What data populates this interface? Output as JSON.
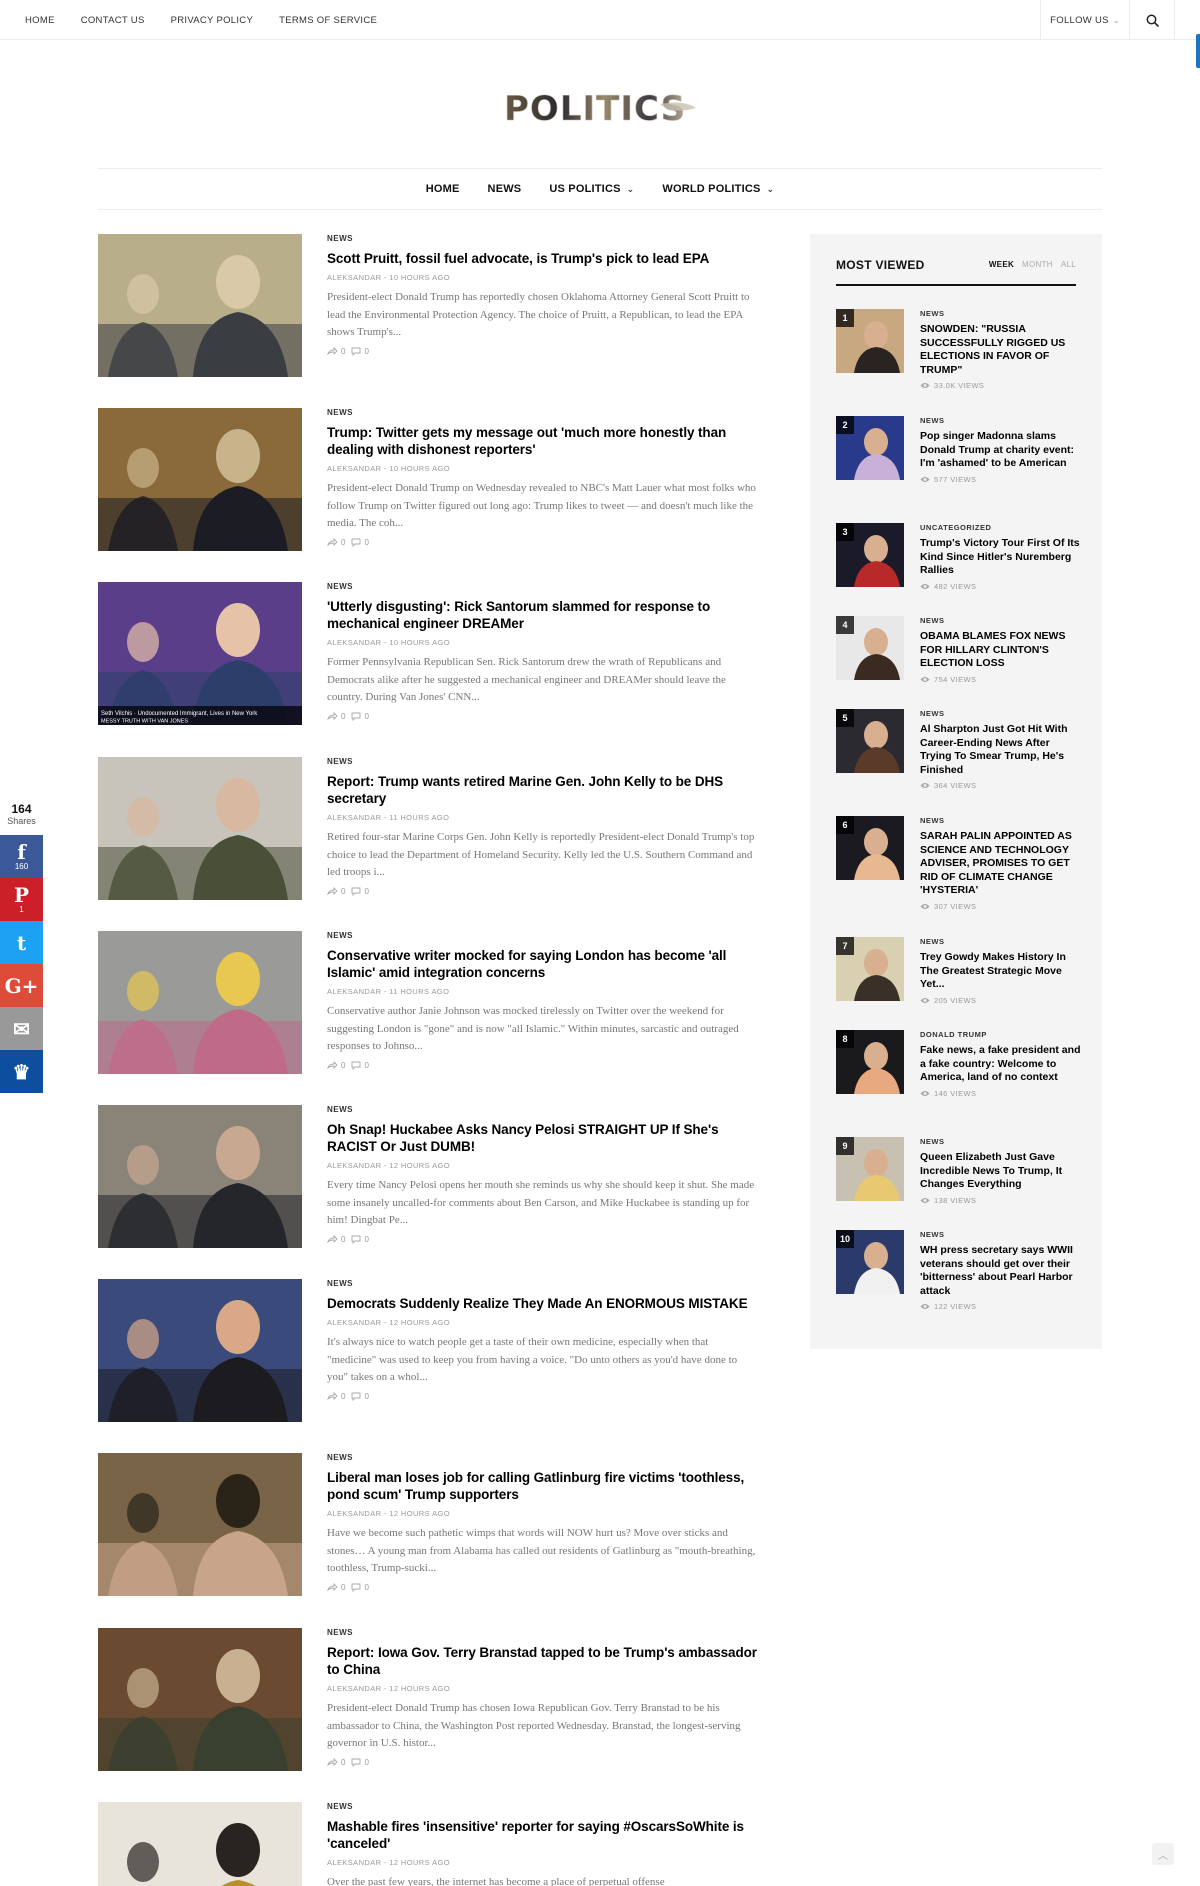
{
  "topnav": {
    "items": [
      "HOME",
      "CONTACT US",
      "PRIVACY POLICY",
      "TERMS OF SERVICE"
    ],
    "follow_label": "FOLLOW US"
  },
  "logo": {
    "text": "POLITICS"
  },
  "mainnav": {
    "items": [
      {
        "label": "HOME",
        "dropdown": false
      },
      {
        "label": "NEWS",
        "dropdown": false
      },
      {
        "label": "US POLITICS",
        "dropdown": true
      },
      {
        "label": "WORLD POLITICS",
        "dropdown": true
      }
    ]
  },
  "articles": [
    {
      "cat": "NEWS",
      "title": "Scott Pruitt, fossil fuel advocate, is Trump's pick to lead EPA",
      "byline": "ALEKSANDAR - 10 HOURS AGO",
      "excerpt": "President-elect Donald Trump has reportedly chosen Oklahoma Attorney General Scott Pruitt to lead the Environmental Protection Agency. The choice of Pruitt, a Republican, to lead the EPA shows Trump's...",
      "shares": "0",
      "comments": "0",
      "thumb_colors": [
        "#b8ae8a",
        "#3a3d42",
        "#d9c9a8"
      ]
    },
    {
      "cat": "NEWS",
      "title": "Trump: Twitter gets my message out 'much more honestly than dealing with dishonest reporters'",
      "byline": "ALEKSANDAR - 10 HOURS AGO",
      "excerpt": "President-elect Donald Trump on Wednesday revealed to NBC's Matt Lauer what most folks who follow Trump on Twitter figured out long ago: Trump likes to tweet — and doesn't much like the media. The coh...",
      "shares": "0",
      "comments": "0",
      "thumb_colors": [
        "#8a6a3a",
        "#1c1c24",
        "#c9b38a"
      ]
    },
    {
      "cat": "NEWS",
      "title": "'Utterly disgusting': Rick Santorum slammed for response to mechanical engineer DREAMer",
      "byline": "ALEKSANDAR - 10 HOURS AGO",
      "excerpt": "Former Pennsylvania Republican Sen. Rick Santorum drew the wrath of Republicans and Democrats alike after he suggested a mechanical engineer and DREAMer should leave the country. During Van Jones' CNN...",
      "shares": "0",
      "comments": "0",
      "thumb_colors": [
        "#5a3e8a",
        "#2c3f6a",
        "#e6c2a8"
      ],
      "caption1": "Seth Vilchis · Undocumented Immigrant, Lives in New York",
      "caption2": "MESSY TRUTH WITH VAN JONES"
    },
    {
      "cat": "NEWS",
      "title": "Report: Trump wants retired Marine Gen. John Kelly to be DHS secretary",
      "byline": "ALEKSANDAR - 11 HOURS AGO",
      "excerpt": "Retired four-star Marine Corps Gen. John Kelly is reportedly President-elect Donald Trump's top choice to lead the Department of Homeland Security. Kelly led the U.S. Southern Command and led troops i...",
      "shares": "0",
      "comments": "0",
      "thumb_colors": [
        "#c8c4bc",
        "#4a5038",
        "#d8b8a0"
      ]
    },
    {
      "cat": "NEWS",
      "title": "Conservative writer mocked for saying London has become 'all Islamic' amid integration concerns",
      "byline": "ALEKSANDAR - 11 HOURS AGO",
      "excerpt": "Conservative author Janie Johnson was mocked tirelessly on Twitter over the weekend for suggesting London is \"gone\" and is now \"all Islamic.\" Within minutes, sarcastic and outraged responses to Johnso...",
      "shares": "0",
      "comments": "0",
      "thumb_colors": [
        "#9a9a98",
        "#c06a8a",
        "#e8c850"
      ]
    },
    {
      "cat": "NEWS",
      "title": "Oh Snap! Huckabee Asks Nancy Pelosi STRAIGHT UP If She's RACIST Or Just DUMB!",
      "byline": "ALEKSANDAR - 12 HOURS AGO",
      "excerpt": "Every time Nancy Pelosi opens her mouth she reminds us why she should keep it shut. She made some insanely uncalled-for comments about Ben Carson, and Mike Huckabee is standing up for him! Dingbat Pe...",
      "shares": "0",
      "comments": "0",
      "thumb_colors": [
        "#8a8478",
        "#24262c",
        "#c8a890"
      ]
    },
    {
      "cat": "NEWS",
      "title": "Democrats Suddenly Realize They Made An ENORMOUS MISTAKE",
      "byline": "ALEKSANDAR - 12 HOURS AGO",
      "excerpt": "It's always nice to watch people get a taste of their own medicine, especially when that \"medicine\" was used to keep you from having a voice. \"Do unto others as you'd have done to you\" takes on a whol...",
      "shares": "0",
      "comments": "0",
      "thumb_colors": [
        "#3a4a7a",
        "#1c1c20",
        "#d8a888"
      ]
    },
    {
      "cat": "NEWS",
      "title": "Liberal man loses job for calling Gatlinburg fire victims 'toothless, pond scum' Trump supporters",
      "byline": "ALEKSANDAR - 12 HOURS AGO",
      "excerpt": "Have we become such pathetic wimps that words will NOW hurt us? Move over sticks and stones… A young man from Alabama has called out residents of Gatlinburg as \"mouth-breathing, toothless, Trump-sucki...",
      "shares": "0",
      "comments": "0",
      "thumb_colors": [
        "#7a6448",
        "#c8a48a",
        "#2a2418"
      ]
    },
    {
      "cat": "NEWS",
      "title": "Report: Iowa Gov. Terry Branstad tapped to be Trump's ambassador to China",
      "byline": "ALEKSANDAR - 12 HOURS AGO",
      "excerpt": "President-elect Donald Trump has chosen Iowa Republican Gov. Terry Branstad to be his ambassador to China, the Washington Post reported Wednesday. Branstad, the longest-serving governor in U.S. histor...",
      "shares": "0",
      "comments": "0",
      "thumb_colors": [
        "#6a4a30",
        "#3a4030",
        "#c8b090"
      ]
    },
    {
      "cat": "NEWS",
      "title": "Mashable fires 'insensitive' reporter for saying #OscarsSoWhite is 'canceled'",
      "byline": "ALEKSANDAR - 12 HOURS AGO",
      "excerpt": "Over the past few years, the internet has become a place of perpetual offense",
      "shares": "0",
      "comments": "0",
      "thumb_colors": [
        "#e8e4dc",
        "#b8902a",
        "#2a2420"
      ]
    }
  ],
  "sidebar": {
    "title": "MOST VIEWED",
    "tabs": [
      {
        "label": "WEEK",
        "active": true
      },
      {
        "label": "MONTH",
        "active": false
      },
      {
        "label": "ALL",
        "active": false
      }
    ],
    "items": [
      {
        "num": "1",
        "cat": "NEWS",
        "title": "SNOWDEN: \"RUSSIA SUCCESSFULLY RIGGED US ELECTIONS IN FAVOR OF TRUMP\"",
        "views": "33.0K VIEWS",
        "colors": [
          "#c8a880",
          "#2a2420"
        ]
      },
      {
        "num": "2",
        "cat": "NEWS",
        "title": "Pop singer Madonna slams Donald Trump at charity event: I'm 'ashamed' to be American",
        "views": "577 VIEWS",
        "colors": [
          "#2a3a8a",
          "#c8b0d8"
        ]
      },
      {
        "num": "3",
        "cat": "UNCATEGORIZED",
        "title": "Trump's Victory Tour First Of Its Kind Since Hitler's Nuremberg Rallies",
        "views": "482 VIEWS",
        "colors": [
          "#1a1a28",
          "#b82a2a"
        ]
      },
      {
        "num": "4",
        "cat": "NEWS",
        "title": "OBAMA BLAMES FOX NEWS FOR HILLARY CLINTON'S ELECTION LOSS",
        "views": "754 VIEWS",
        "colors": [
          "#e8e8e8",
          "#3a2a20"
        ]
      },
      {
        "num": "5",
        "cat": "NEWS",
        "title": "Al Sharpton Just Got Hit With Career-Ending News After Trying To Smear Trump, He's Finished",
        "views": "364 VIEWS",
        "colors": [
          "#2a2a30",
          "#5a3a28"
        ]
      },
      {
        "num": "6",
        "cat": "NEWS",
        "title": "SARAH PALIN APPOINTED AS SCIENCE AND TECHNOLOGY ADVISER, PROMISES TO GET RID OF CLIMATE CHANGE 'HYSTERIA'",
        "views": "307 VIEWS",
        "colors": [
          "#1a1a20",
          "#e8b890"
        ]
      },
      {
        "num": "7",
        "cat": "NEWS",
        "title": "Trey Gowdy Makes History In The Greatest Strategic Move Yet...",
        "views": "205 VIEWS",
        "colors": [
          "#d8d0b0",
          "#3a3028"
        ]
      },
      {
        "num": "8",
        "cat": "DONALD TRUMP",
        "title": "Fake news, a fake president and a fake country: Welcome to America, land of no context",
        "views": "146 VIEWS",
        "colors": [
          "#1a1a1c",
          "#e8a880"
        ]
      },
      {
        "num": "9",
        "cat": "NEWS",
        "title": "Queen Elizabeth Just Gave Incredible News To Trump, It Changes Everything",
        "views": "138 VIEWS",
        "colors": [
          "#c8c0b0",
          "#e8c870"
        ]
      },
      {
        "num": "10",
        "cat": "NEWS",
        "title": "WH press secretary says WWII veterans should get over their 'bitterness' about Pearl Harbor attack",
        "views": "122 VIEWS",
        "colors": [
          "#2a3a6a",
          "#f0f0f0"
        ]
      }
    ]
  },
  "share": {
    "total": "164",
    "total_label": "Shares",
    "buttons": [
      {
        "name": "facebook",
        "glyph": "f",
        "count": "160",
        "color": "#3b5998"
      },
      {
        "name": "pinterest",
        "glyph": "P",
        "count": "1",
        "color": "#cb2027"
      },
      {
        "name": "twitter",
        "glyph": "t",
        "count": "",
        "color": "#1da1f2"
      },
      {
        "name": "google-plus",
        "glyph": "G+",
        "count": "",
        "color": "#dd4b39"
      },
      {
        "name": "email",
        "glyph": "✉",
        "count": "",
        "color": "#999999"
      },
      {
        "name": "sumo",
        "glyph": "♛",
        "count": "",
        "color": "#0d4f9e"
      }
    ]
  }
}
